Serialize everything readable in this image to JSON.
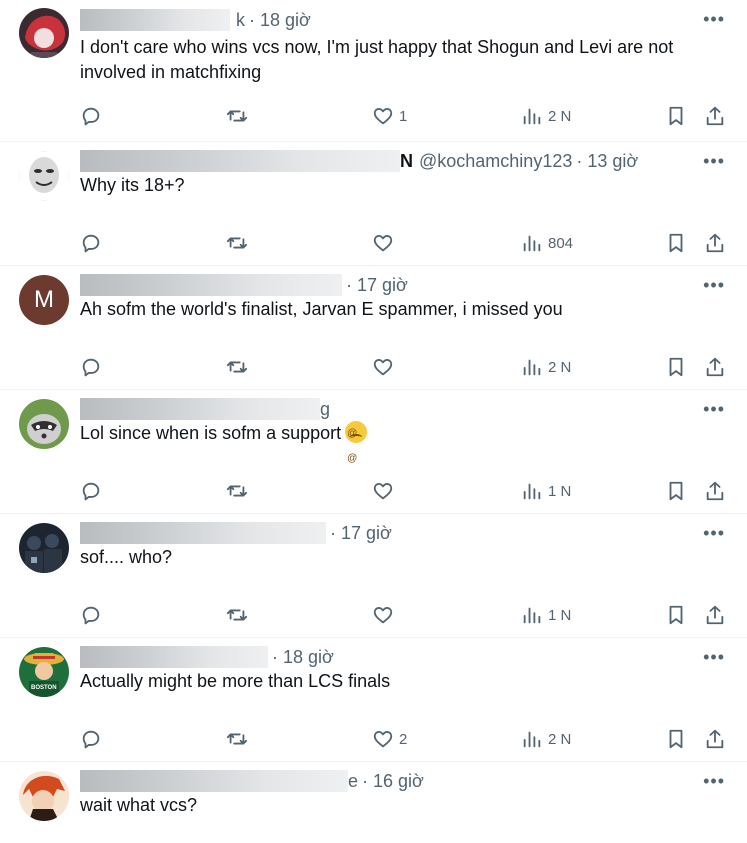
{
  "tweets": [
    {
      "handle": "",
      "handle_tail": "k",
      "time": "· 18 giờ",
      "text": "I don't care who wins vcs now, I'm just happy that Shogun and Levi are not involved in matchfixing",
      "replies": "",
      "retweets": "",
      "likes": "1",
      "views": "2 N",
      "avatar": "red-haired-character-avatar",
      "colors": [
        "#3c2a32",
        "#c8333b",
        "#f1dede"
      ]
    },
    {
      "handle": "@kochamchiny123",
      "handle_tail": "N",
      "time": "· 13 giờ",
      "text": "Why its 18+?",
      "replies": "",
      "retweets": "",
      "likes": "",
      "views": "804",
      "avatar": "meme-face-avatar",
      "colors": [
        "#ffffff",
        "#d9d9d9",
        "#2d2d2d"
      ]
    },
    {
      "handle": "",
      "handle_tail": "",
      "time": "· 17 giờ",
      "text": "Ah sofm the world's finalist, Jarvan E spammer, i missed you",
      "replies": "",
      "retweets": "",
      "likes": "",
      "views": "2 N",
      "avatar": "letter-m-avatar",
      "avatar_letter": "M",
      "colors": [
        "#6d3a30"
      ]
    },
    {
      "handle": "",
      "handle_tail": "g",
      "time": "",
      "text": "Lol since when is sofm a support",
      "replies": "",
      "retweets": "",
      "likes": "",
      "views": "1 N",
      "avatar": "raccoon-avatar",
      "emoji": "woozy-face-emoji",
      "colors": [
        "#6f9a4c",
        "#cfcfcf",
        "#303030"
      ]
    },
    {
      "handle": "",
      "handle_tail": "",
      "time": "· 17 giờ",
      "text": "sof.... who?",
      "replies": "",
      "retweets": "",
      "likes": "",
      "views": "1 N",
      "avatar": "group-photo-avatar",
      "colors": [
        "#1c2530",
        "#3a4a5c",
        "#8fa4b8"
      ]
    },
    {
      "handle": "",
      "handle_tail": "",
      "time": "· 18 giờ",
      "text": "Actually might be more than LCS finals",
      "replies": "",
      "retweets": "",
      "likes": "2",
      "views": "2 N",
      "avatar": "straw-hat-boston-avatar",
      "avatar_text": "BOSTON",
      "colors": [
        "#1f6f3c",
        "#e0b23b",
        "#c0392b"
      ]
    },
    {
      "handle": "",
      "handle_tail": "e",
      "time": "· 16 giờ",
      "text": "wait what vcs?",
      "replies": "",
      "retweets": "",
      "likes": "",
      "views": "",
      "avatar": "anime-character-avatar",
      "colors": [
        "#d24a1e",
        "#f2d2b6",
        "#2b1c15"
      ]
    }
  ]
}
